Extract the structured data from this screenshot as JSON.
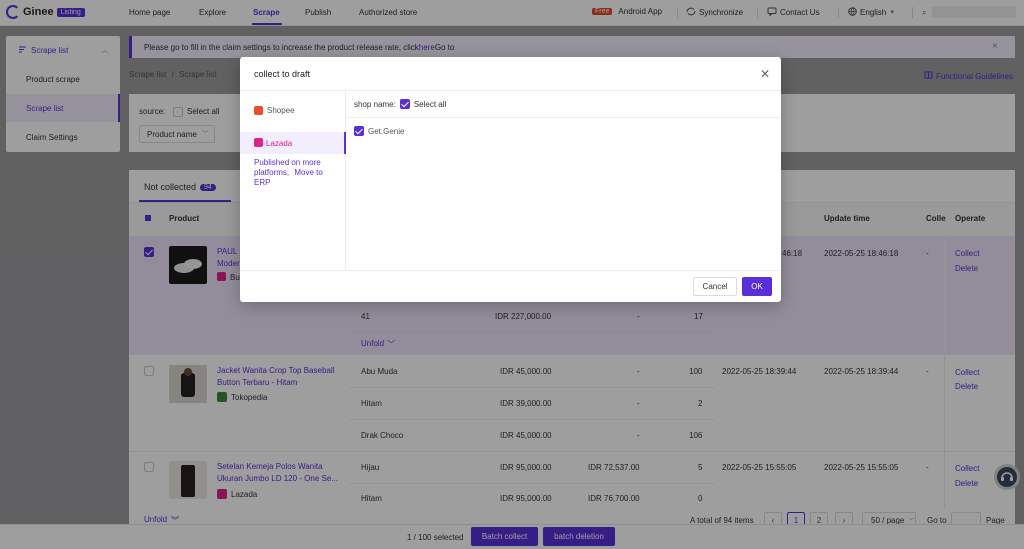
{
  "brand": {
    "name": "Ginee",
    "badge": "Listing"
  },
  "nav": {
    "items": [
      "Home page",
      "Explore",
      "Scrape",
      "Publish",
      "Authorized store"
    ],
    "active": "Scrape",
    "free_badge": "Free",
    "android": "Android App",
    "sync": "Synchronize",
    "contact": "Contact Us",
    "language": "English"
  },
  "sidebar": {
    "header": "Scrape list",
    "items": [
      "Product scrape",
      "Scrape list",
      "Claim Settings"
    ],
    "active": "Scrape list"
  },
  "banner": {
    "text": "Please go to fill in the claim settings to increase the product release rate, click",
    "link": "here",
    "tail": "Go to"
  },
  "breadcrumb": {
    "parent": "Scrape list",
    "sep": "/",
    "current": "Scrape list"
  },
  "guide": "Functional Guidelines",
  "filter": {
    "source_label": "source:",
    "select_all": "Select all",
    "product_name": "Product name"
  },
  "tabs": {
    "not_collected": "Not collected",
    "count": "94"
  },
  "table": {
    "headers": {
      "product": "Product",
      "update_time": "Update time",
      "colle": "Colle",
      "operate": "Operate"
    },
    "rows": [
      {
        "name_line1": "PAUL",
        "name_line2": "Moder",
        "store": "Bu",
        "time1": "46:18",
        "time2": "2022-05-25 18:46:18",
        "dash": "-",
        "actions": [
          "Collect",
          "Delete"
        ],
        "variants": [
          {
            "v": "41",
            "price": "IDR 227,000.00",
            "disc": "-",
            "stock": "17"
          }
        ],
        "unfold": "Unfold"
      },
      {
        "name_line1": "Jacket Wanita Crop Top Baseball",
        "name_line2": "Button Terbaru - Hitam",
        "store": "Tokopedia",
        "time1": "2022-05-25 18:39:44",
        "time2": "2022-05-25 18:39:44",
        "dash": "-",
        "actions": [
          "Collect",
          "Delete"
        ],
        "variants": [
          {
            "v": "Abu Muda",
            "price": "IDR 45,000.00",
            "disc": "-",
            "stock": "100"
          },
          {
            "v": "Hitam",
            "price": "IDR 39,000.00",
            "disc": "-",
            "stock": "2"
          },
          {
            "v": "Drak Choco",
            "price": "IDR 45,000.00",
            "disc": "-",
            "stock": "106"
          }
        ]
      },
      {
        "name_line1": "Setelan Kemeja Polos Wanita",
        "name_line2": "Ukuran Jumbo LD 120 - One Se...",
        "store": "Lazada",
        "time1": "2022-05-25 15:55:05",
        "time2": "2022-05-25 15:55:05",
        "dash": "-",
        "actions": [
          "Collect",
          "Delete"
        ],
        "variants": [
          {
            "v": "Hijau",
            "price": "IDR 95,000.00",
            "disc": "IDR 72,537.00",
            "stock": "5"
          },
          {
            "v": "Hitam",
            "price": "IDR 95,000.00",
            "disc": "IDR 76,700.00",
            "stock": "0"
          }
        ]
      }
    ]
  },
  "footer": {
    "unfold": "Unfold",
    "total": "A total of 94 items",
    "pages": [
      "1",
      "2"
    ],
    "per_page": "50 / page",
    "goto": "Go to",
    "page": "Page"
  },
  "bottombar": {
    "selected": "1 / 100 selected",
    "batch_collect": "Batch collect",
    "batch_delete": "batch deletion"
  },
  "modal": {
    "title": "collect to draft",
    "platforms": [
      "Shopee",
      "Lazada"
    ],
    "active_platform": "Lazada",
    "published_note": "Published on more platforms,",
    "move_link": "Move to ERP",
    "shop_label": "shop name:",
    "select_all": "Select all",
    "shops": [
      "Get.Genie"
    ],
    "cancel": "Cancel",
    "ok": "OK"
  },
  "colors": {
    "accent": "#5a2fd8",
    "shopee": "#ee4d2d",
    "lazada": "#e0218a"
  }
}
